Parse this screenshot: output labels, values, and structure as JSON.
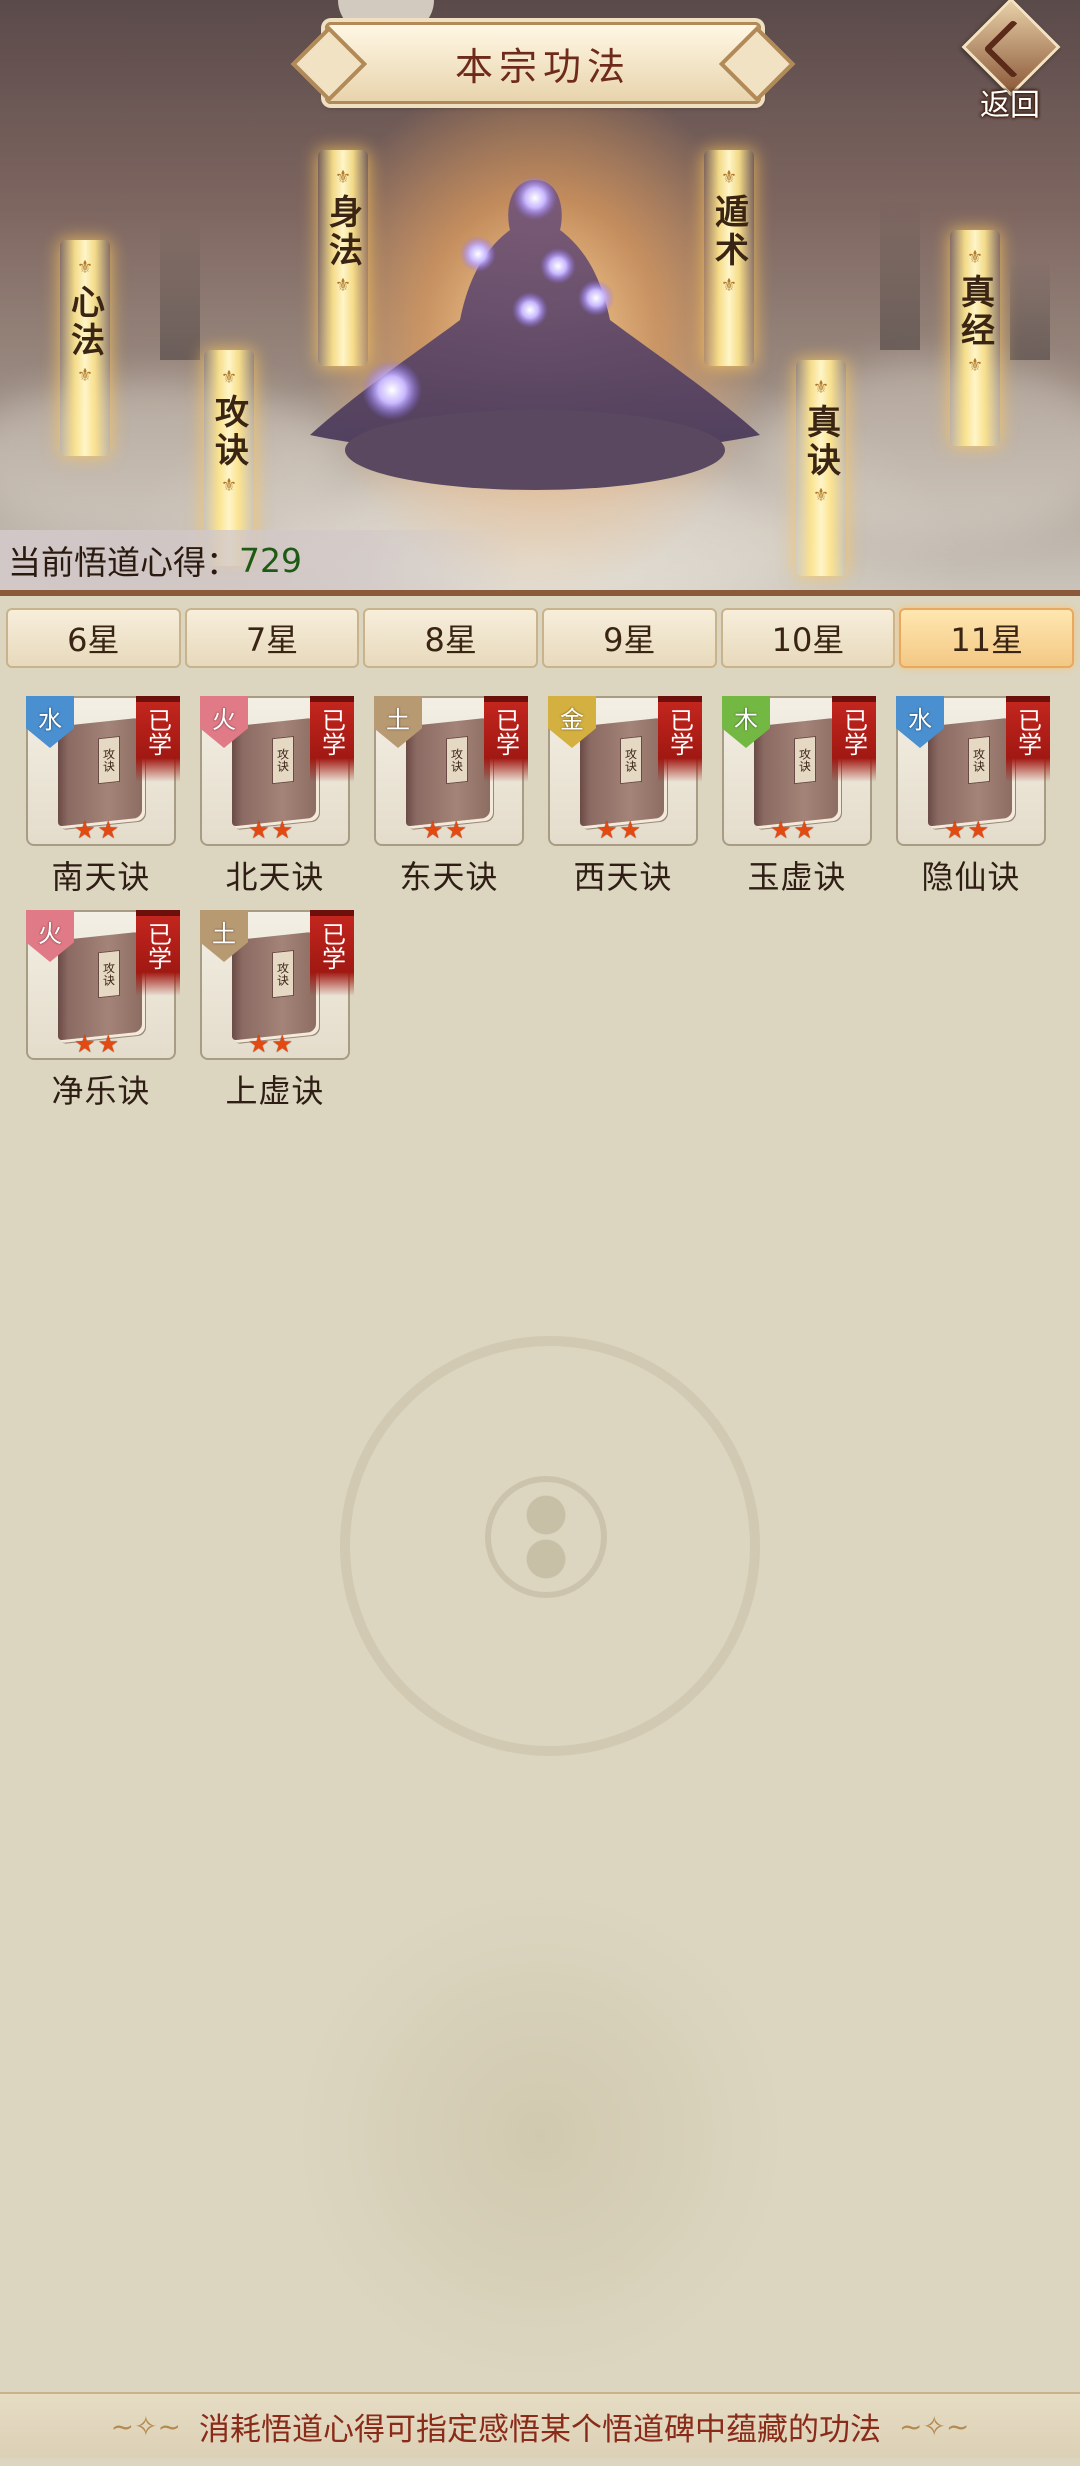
{
  "header": {
    "title": "本宗功法",
    "back_label": "返回"
  },
  "hero": {
    "categories": [
      "心法",
      "攻诀",
      "身法",
      "遁术",
      "真诀",
      "真经"
    ],
    "insight_label": "当前悟道心得：",
    "insight_value": "729"
  },
  "tabs": [
    "6星",
    "7星",
    "8星",
    "9星",
    "10星",
    "11星"
  ],
  "active_tab": "11星",
  "items": [
    {
      "name": "南天诀",
      "element": "水",
      "badge": "已学",
      "book_title": "攻诀",
      "stars": 2
    },
    {
      "name": "北天诀",
      "element": "火",
      "badge": "已学",
      "book_title": "攻诀",
      "stars": 2
    },
    {
      "name": "东天诀",
      "element": "土",
      "badge": "已学",
      "book_title": "攻诀",
      "stars": 2
    },
    {
      "name": "西天诀",
      "element": "金",
      "badge": "已学",
      "book_title": "攻诀",
      "stars": 2
    },
    {
      "name": "玉虚诀",
      "element": "木",
      "badge": "已学",
      "book_title": "攻诀",
      "stars": 2
    },
    {
      "name": "隐仙诀",
      "element": "水",
      "badge": "已学",
      "book_title": "攻诀",
      "stars": 2
    },
    {
      "name": "净乐诀",
      "element": "火",
      "badge": "已学",
      "book_title": "攻诀",
      "stars": 2
    },
    {
      "name": "上虚诀",
      "element": "土",
      "badge": "已学",
      "book_title": "攻诀",
      "stars": 2
    }
  ],
  "element_colors": {
    "水": "#4a8fd0",
    "火": "#e07a86",
    "土": "#b89a72",
    "金": "#d4b040",
    "木": "#74b844"
  },
  "footer": {
    "hint": "消耗悟道心得可指定感悟某个悟道碑中蕴藏的功法"
  }
}
